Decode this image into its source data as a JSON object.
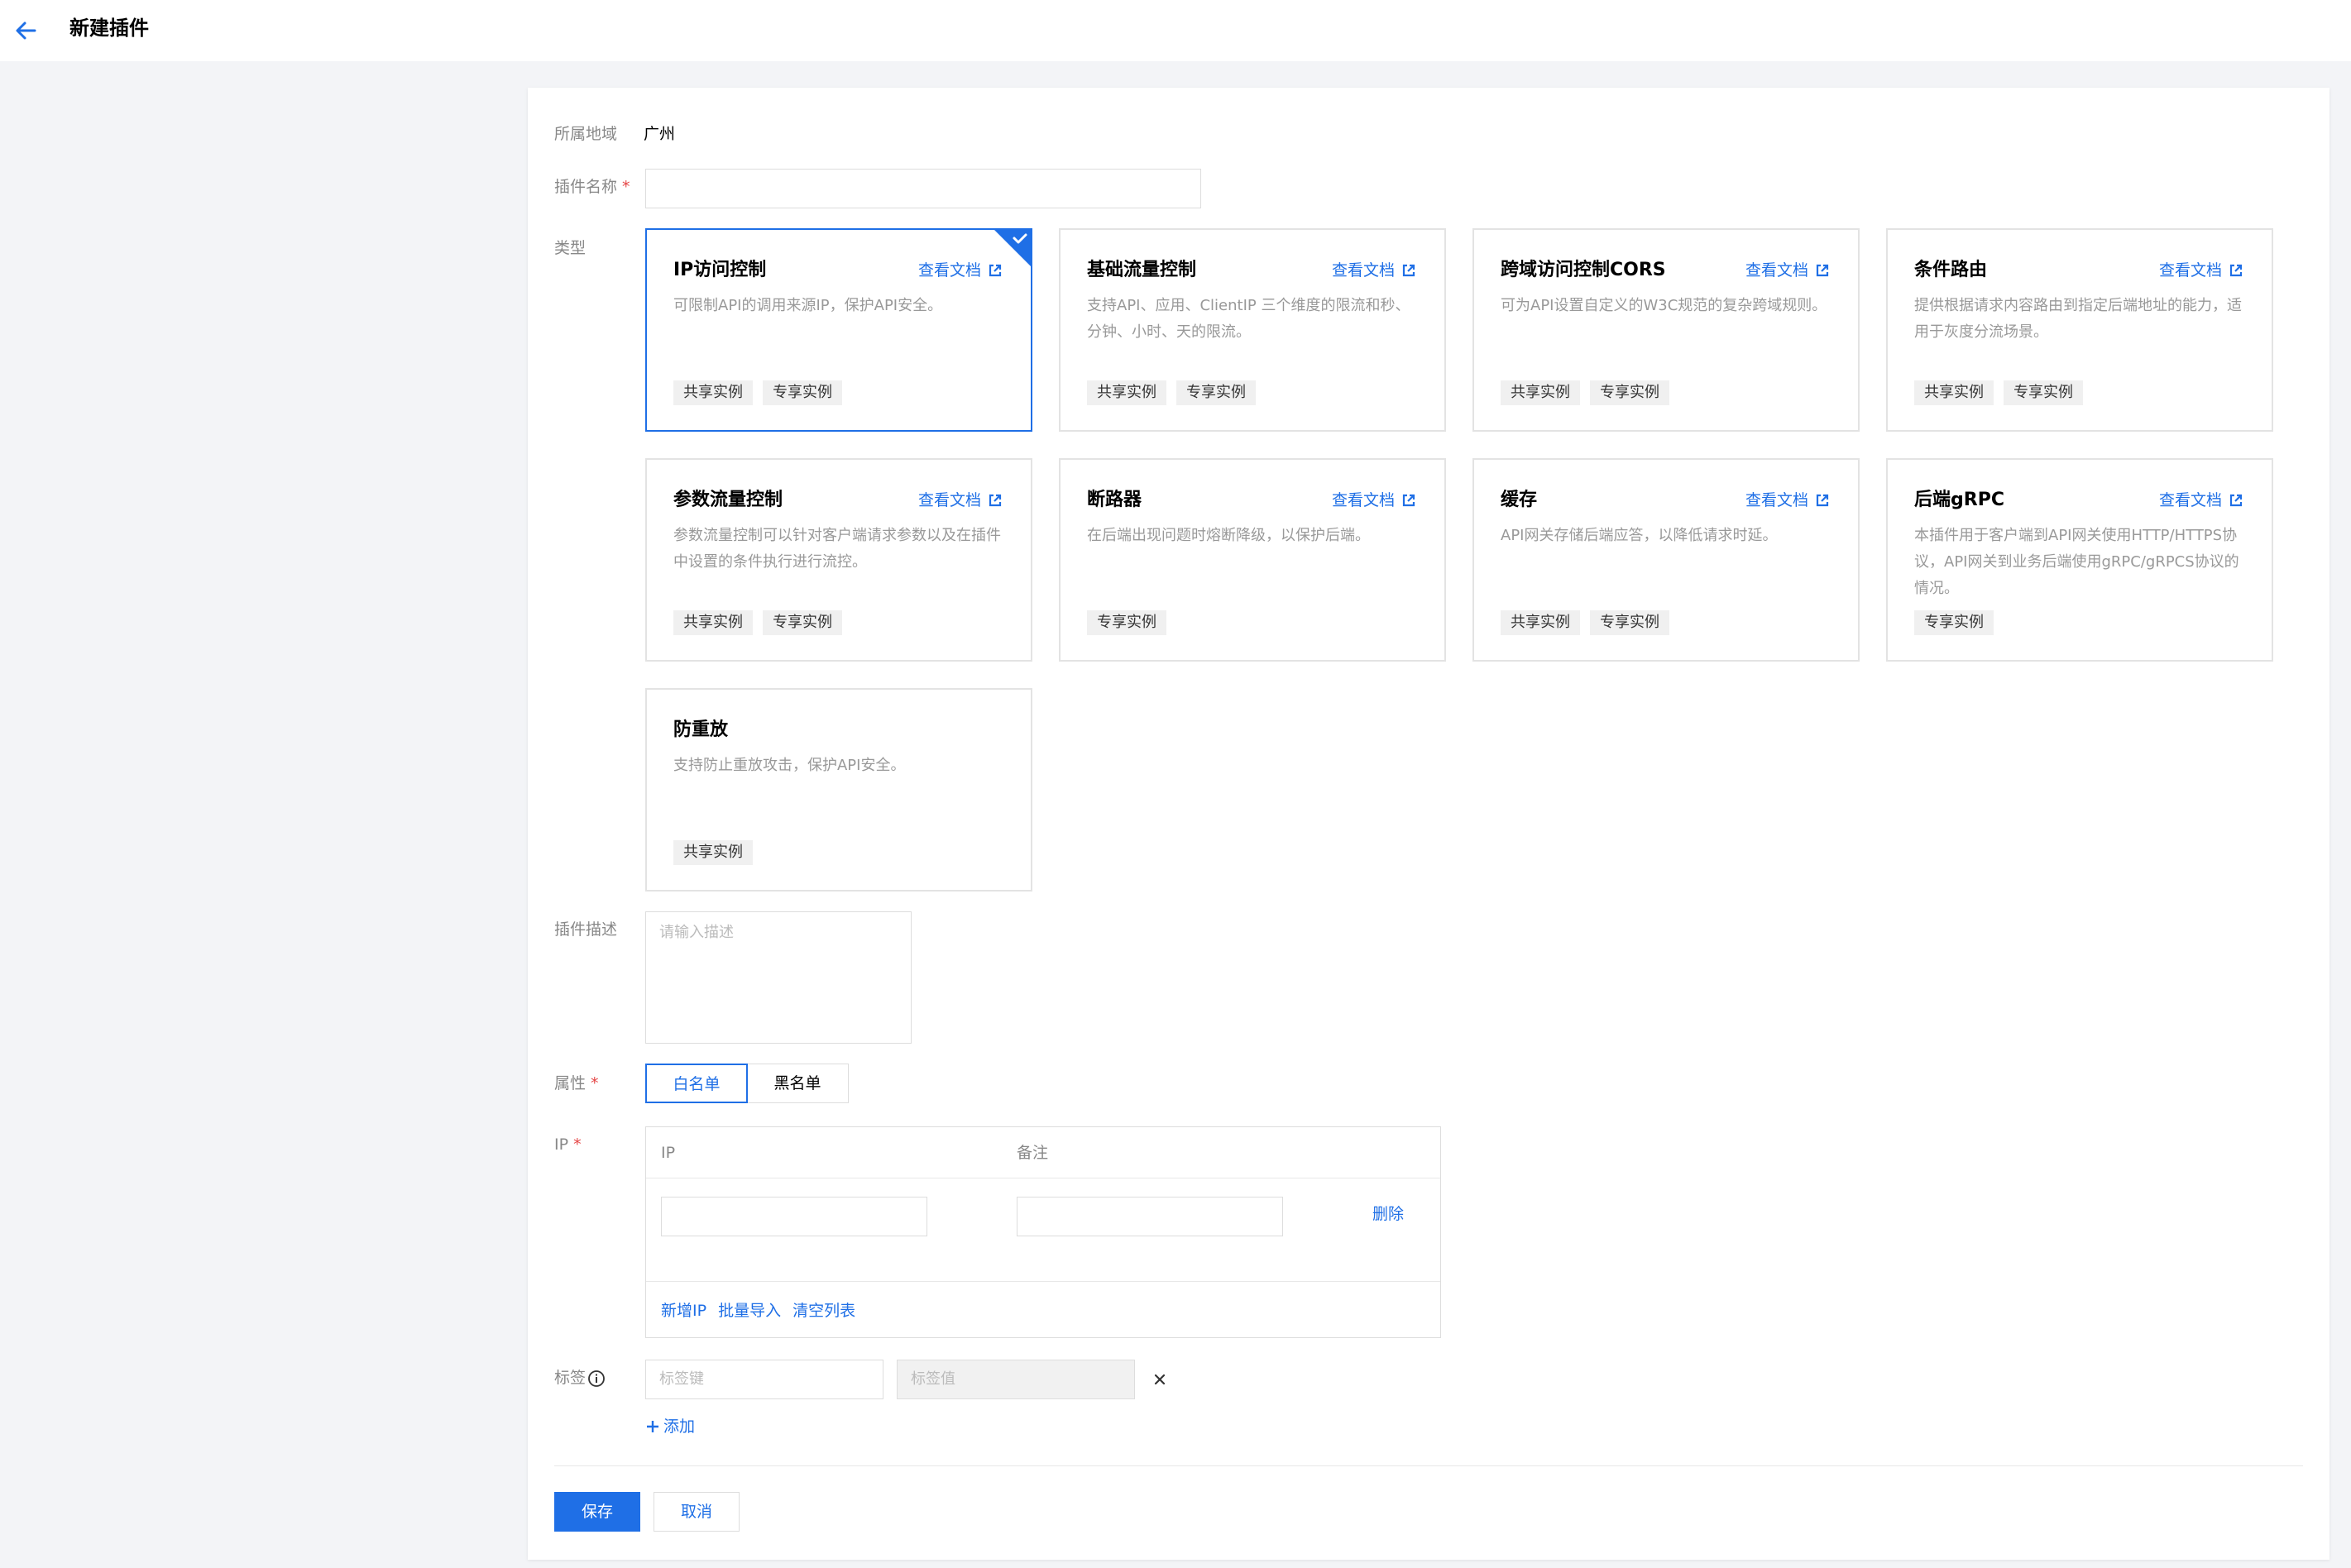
{
  "header": {
    "title": "新建插件",
    "back_icon": "arrow-left-icon"
  },
  "form": {
    "region_label": "所属地域",
    "region_value": "广州",
    "name_label": "插件名称",
    "required_mark": "*",
    "type_label": "类型",
    "doc_link_label": "查看文档",
    "cards": [
      {
        "title": "IP访问控制",
        "desc": "可限制API的调用来源IP，保护API安全。",
        "has_doc": true,
        "selected": true,
        "tags": [
          "共享实例",
          "专享实例"
        ]
      },
      {
        "title": "基础流量控制",
        "desc": "支持API、应用、ClientIP 三个维度的限流和秒、分钟、小时、天的限流。",
        "has_doc": true,
        "selected": false,
        "tags": [
          "共享实例",
          "专享实例"
        ]
      },
      {
        "title": "跨域访问控制CORS",
        "desc": "可为API设置自定义的W3C规范的复杂跨域规则。",
        "has_doc": true,
        "selected": false,
        "tags": [
          "共享实例",
          "专享实例"
        ]
      },
      {
        "title": "条件路由",
        "desc": "提供根据请求内容路由到指定后端地址的能力，适用于灰度分流场景。",
        "has_doc": true,
        "selected": false,
        "tags": [
          "共享实例",
          "专享实例"
        ]
      },
      {
        "title": "参数流量控制",
        "desc": "参数流量控制可以针对客户端请求参数以及在插件中设置的条件执行进行流控。",
        "has_doc": true,
        "selected": false,
        "tags": [
          "共享实例",
          "专享实例"
        ]
      },
      {
        "title": "断路器",
        "desc": "在后端出现问题时熔断降级，以保护后端。",
        "has_doc": true,
        "selected": false,
        "tags": [
          "专享实例"
        ]
      },
      {
        "title": "缓存",
        "desc": "API网关存储后端应答，以降低请求时延。",
        "has_doc": true,
        "selected": false,
        "tags": [
          "共享实例",
          "专享实例"
        ]
      },
      {
        "title": "后端gRPC",
        "desc": "本插件用于客户端到API网关使用HTTP/HTTPS协议，API网关到业务后端使用gRPC/gRPCS协议的情况。",
        "has_doc": true,
        "selected": false,
        "tags": [
          "专享实例"
        ]
      },
      {
        "title": "防重放",
        "desc": "支持防止重放攻击，保护API安全。",
        "has_doc": false,
        "selected": false,
        "tags": [
          "共享实例"
        ]
      }
    ],
    "desc_label": "插件描述",
    "desc_placeholder": "请输入描述",
    "attr_label": "属性",
    "attr_options": [
      "白名单",
      "黑名单"
    ],
    "attr_selected": "白名单",
    "ip_label": "IP",
    "ip_table": {
      "col_ip": "IP",
      "col_note": "备注",
      "delete_label": "删除",
      "links": [
        "新增IP",
        "批量导入",
        "清空列表"
      ]
    },
    "tags_label": "标签",
    "tag_key_placeholder": "标签键",
    "tag_value_placeholder": "标签值",
    "add_label": "添加",
    "save_label": "保存",
    "cancel_label": "取消"
  },
  "colors": {
    "accent": "#1f6fe6",
    "required": "#e54545",
    "background": "#f3f4f7"
  }
}
